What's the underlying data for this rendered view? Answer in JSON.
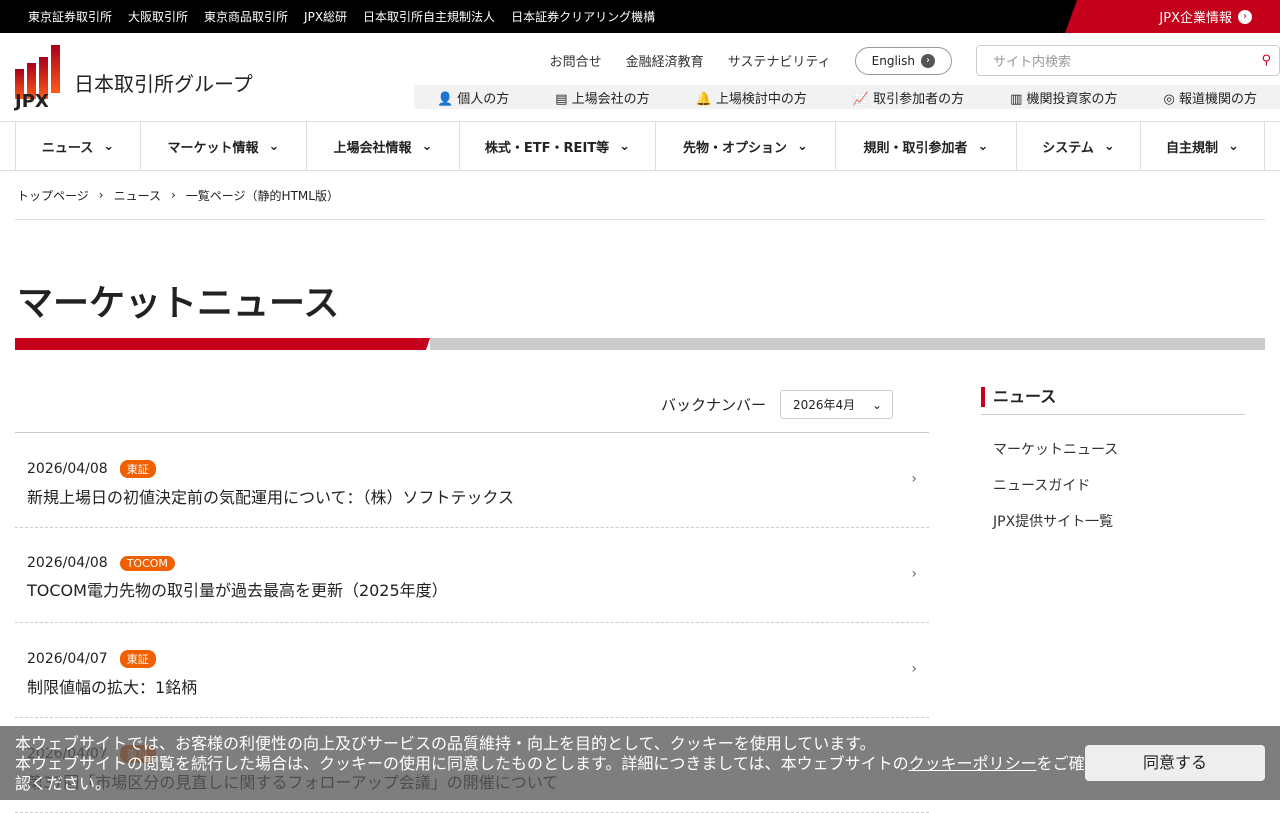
{
  "topbar": {
    "links": [
      "東京証券取引所",
      "大阪取引所",
      "東京商品取引所",
      "JPX総研",
      "日本取引所自主規制法人",
      "日本証券クリアリング機構"
    ],
    "corp": "JPX企業情報"
  },
  "header": {
    "logo_name": "日本取引所グループ",
    "logo_mark": "JPX",
    "util": [
      "お問合せ",
      "金融経済教育",
      "サステナビリティ"
    ],
    "english": "English",
    "search_placeholder": "サイト内検索",
    "audience": [
      "個人の方",
      "上場会社の方",
      "上場検討中の方",
      "取引参加者の方",
      "機関投資家の方",
      "報道機関の方"
    ]
  },
  "nav": [
    "ニュース",
    "マーケット情報",
    "上場会社情報",
    "株式・ETF・REIT等",
    "先物・オプション",
    "規則・取引参加者",
    "システム",
    "自主規制"
  ],
  "breadcrumb": [
    "トップページ",
    "ニュース",
    "一覧ページ（静的HTML版）"
  ],
  "title": "マーケットニュース",
  "backnumber": {
    "label": "バックナンバー",
    "selected": "2026年4月"
  },
  "news": [
    {
      "date": "2026/04/08",
      "badge": "東証",
      "title": "新規上場日の初値決定前の気配運用について：（株）ソフトテックス"
    },
    {
      "date": "2026/04/08",
      "badge": "TOCOM",
      "title": "TOCOM電力先物の取引量が過去最高を更新（2025年度）"
    },
    {
      "date": "2026/04/07",
      "badge": "東証",
      "title": "制限値幅の拡大：1銘柄"
    },
    {
      "date": "2026/04/07",
      "badge": "東証",
      "title": "第37回「市場区分の見直しに関するフォローアップ会議」の開催について"
    }
  ],
  "side": {
    "heading": "ニュース",
    "links": [
      "マーケットニュース",
      "ニュースガイド",
      "JPX提供サイト一覧"
    ]
  },
  "cookie": {
    "line1": "本ウェブサイトでは、お客様の利便性の向上及びサービスの品質維持・向上を目的として、クッキーを使用しています。",
    "line2": "本ウェブサイトの閲覧を続行した場合は、クッキーの使用に同意したものとします。詳細につきましては、本ウェブサイトの",
    "link": "クッキーポリシー",
    "line3": "をご確認ください。",
    "agree": "同意する"
  }
}
